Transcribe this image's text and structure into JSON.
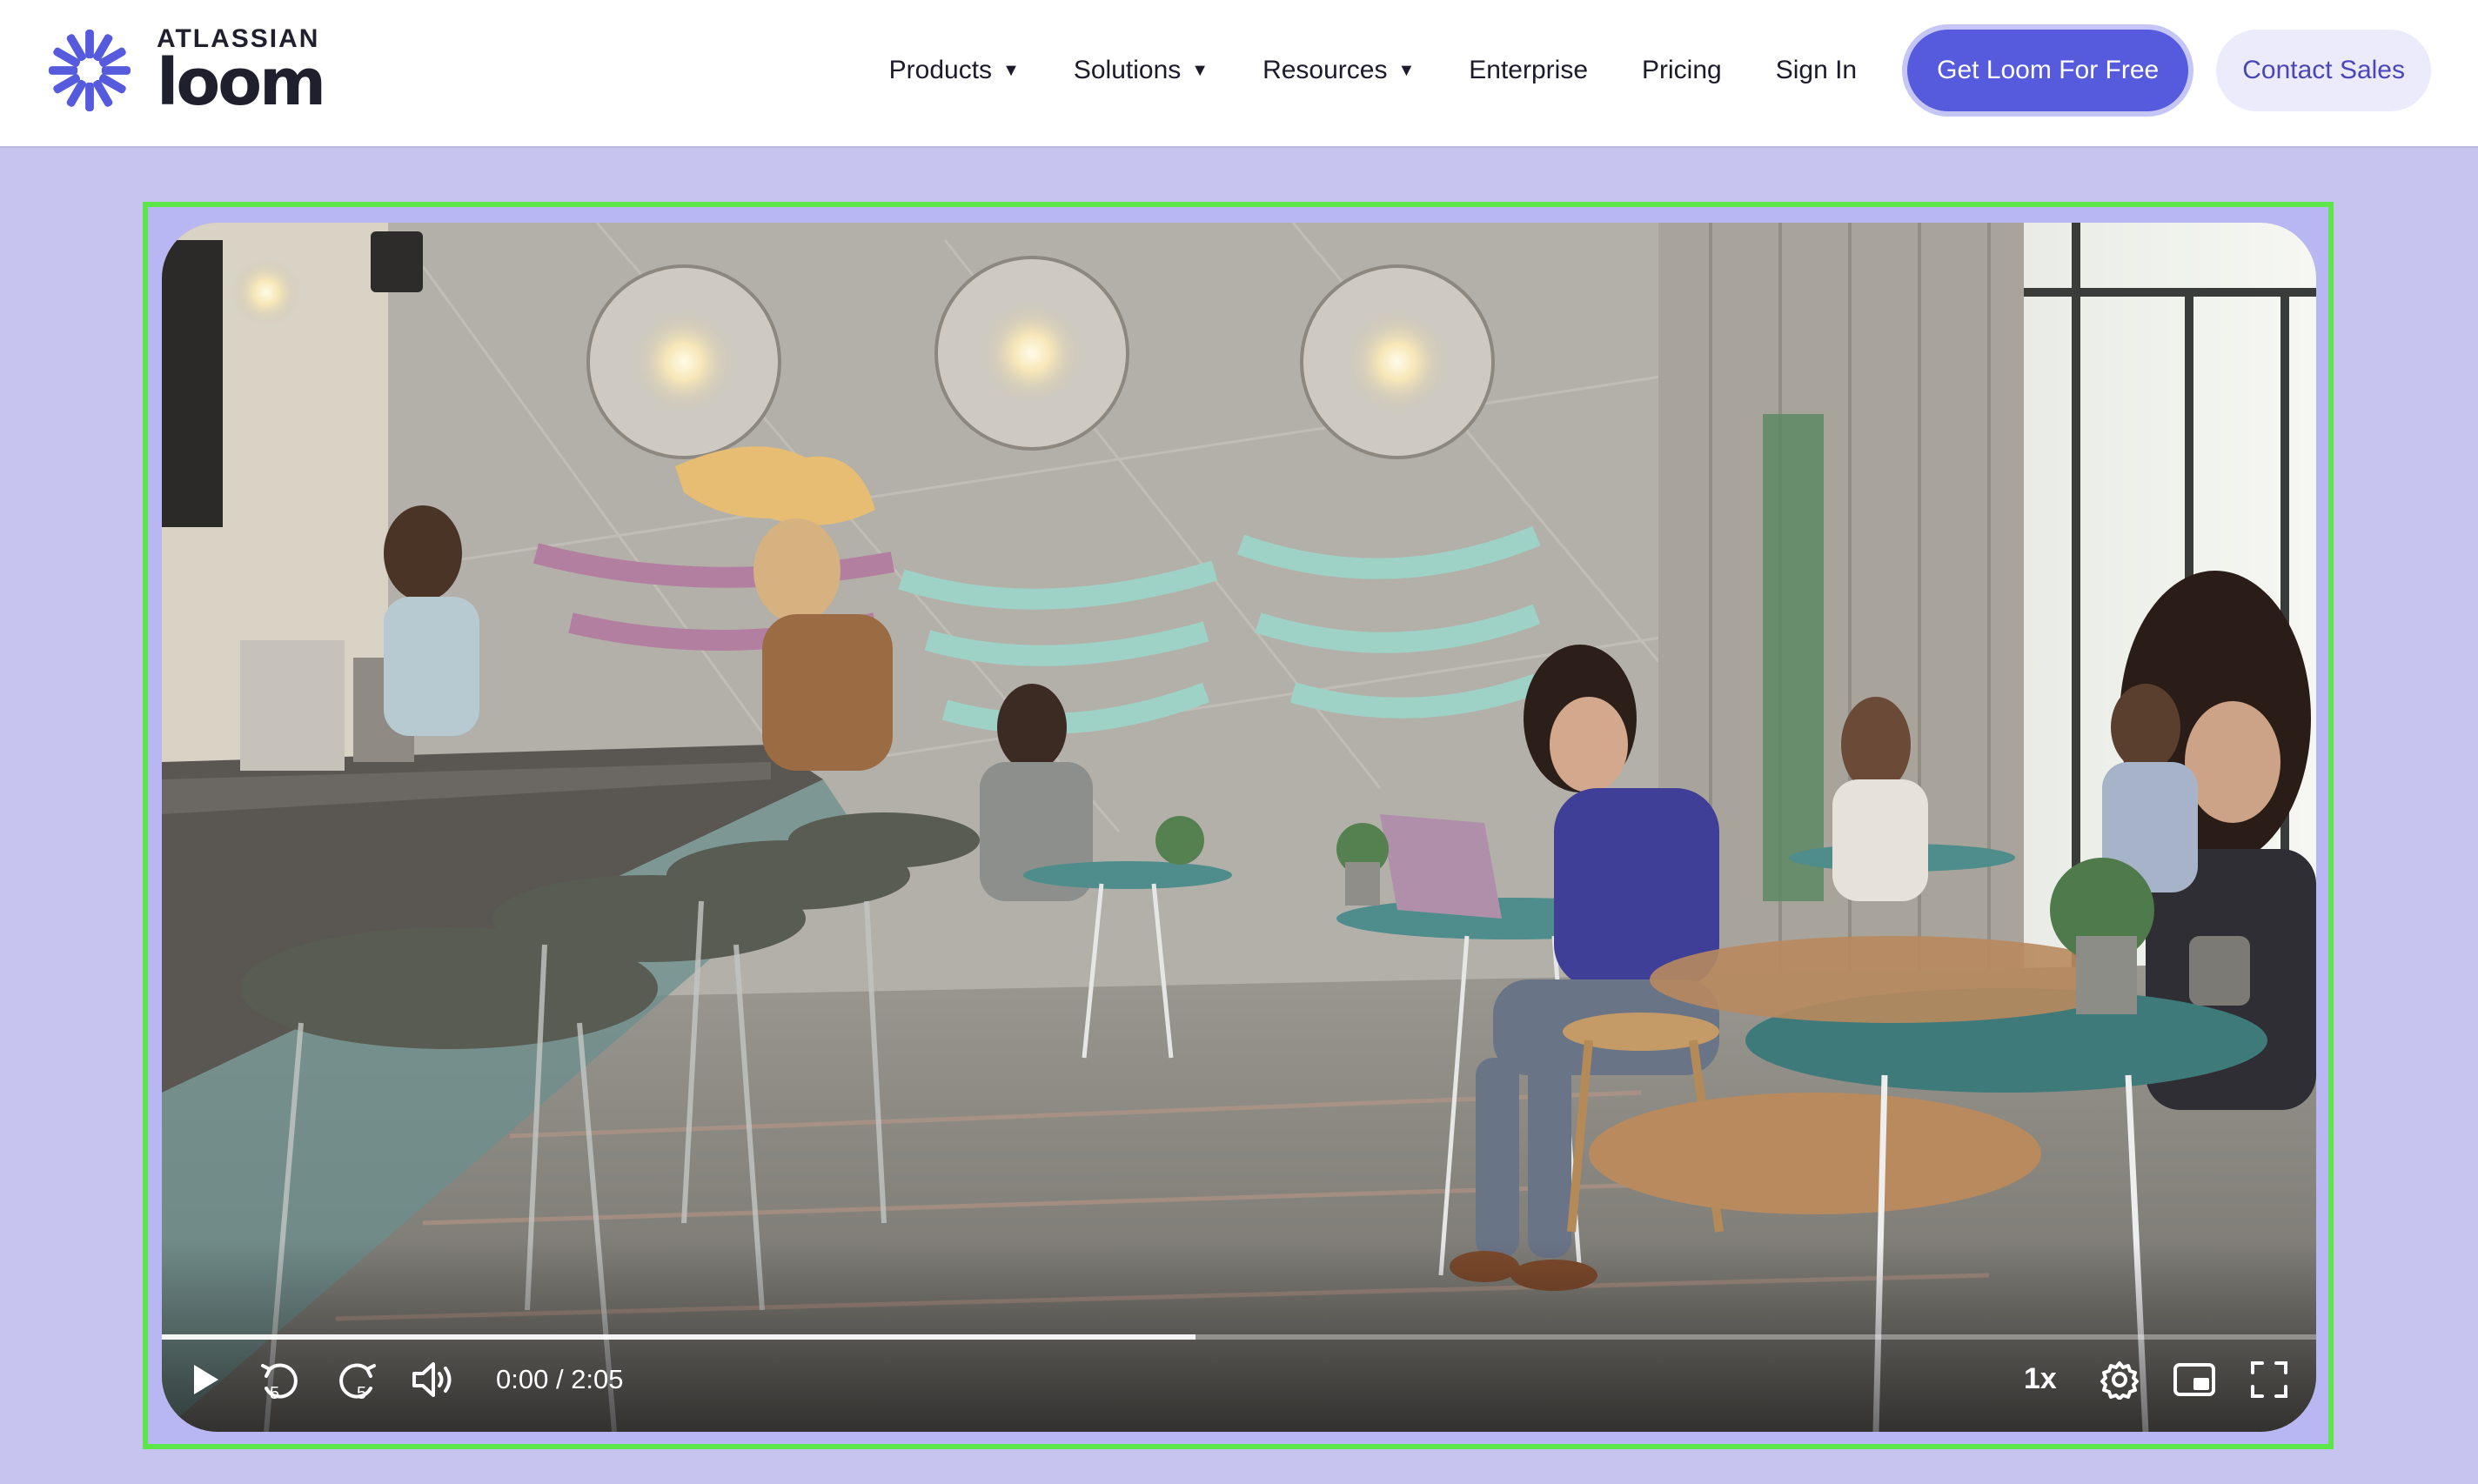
{
  "brand": {
    "company": "ATLASSIAN",
    "product": "loom",
    "accent": "#565add"
  },
  "nav": {
    "products": "Products",
    "solutions": "Solutions",
    "resources": "Resources",
    "enterprise": "Enterprise",
    "pricing": "Pricing",
    "sign_in": "Sign In",
    "cta_primary": "Get Loom For Free",
    "cta_secondary": "Contact Sales"
  },
  "player": {
    "current_time": "0:00",
    "separator": " / ",
    "duration": "2:05",
    "speed": "1x",
    "progress_fraction": 0.48,
    "skip_back_seconds": "5",
    "skip_forward_seconds": "5",
    "icons": [
      "play-icon",
      "rewind-5-icon",
      "forward-5-icon",
      "volume-icon",
      "settings-icon",
      "picture-in-picture-icon",
      "fullscreen-icon"
    ]
  }
}
